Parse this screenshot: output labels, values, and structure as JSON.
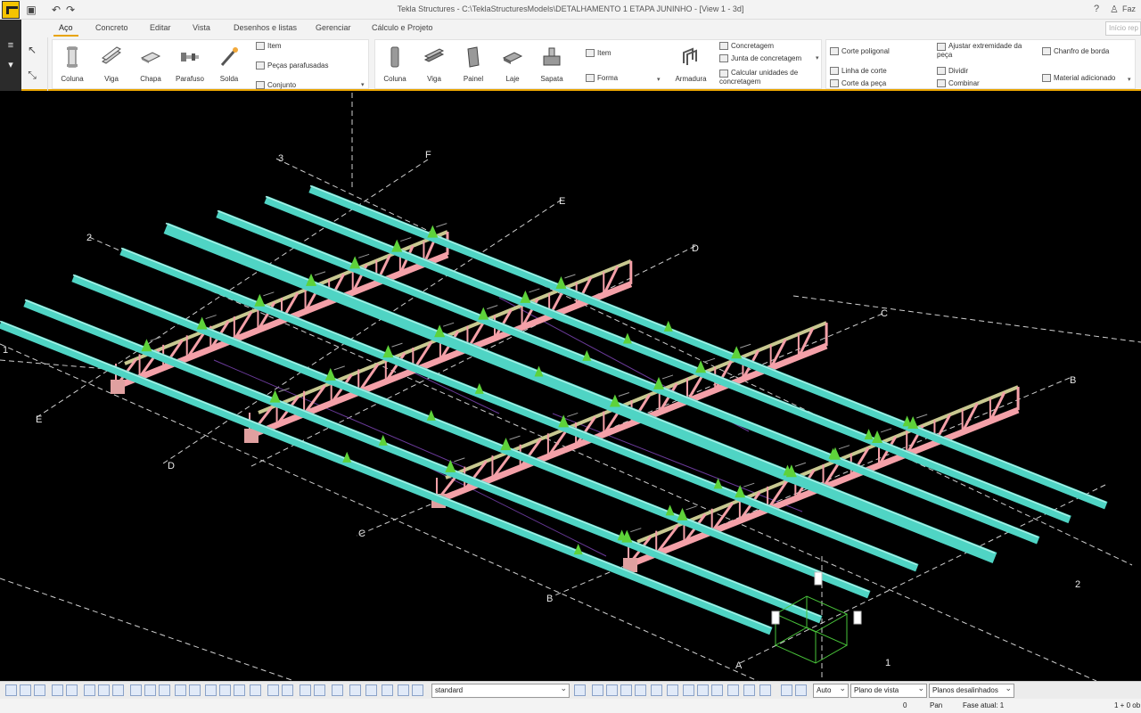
{
  "window": {
    "title": "Tekla Structures - C:\\TeklaStructuresModels\\DETALHAMENTO 1 ETAPA JUNINHO - [View 1 - 3d]",
    "help": "?",
    "user": "Faz"
  },
  "menu": {
    "tabs": [
      {
        "label": "Aço",
        "active": true
      },
      {
        "label": "Concreto"
      },
      {
        "label": "Editar"
      },
      {
        "label": "Vista"
      },
      {
        "label": "Desenhos e listas"
      },
      {
        "label": "Gerenciar"
      },
      {
        "label": "Cálculo e Projeto"
      }
    ],
    "search_placeholder": "Início rep"
  },
  "ribbon": {
    "steel": {
      "buttons": [
        {
          "label": "Coluna",
          "icon": "steel-column-icon"
        },
        {
          "label": "Viga",
          "icon": "steel-beam-icon"
        },
        {
          "label": "Chapa",
          "icon": "plate-icon"
        },
        {
          "label": "Parafuso",
          "icon": "bolt-icon"
        },
        {
          "label": "Solda",
          "icon": "weld-icon"
        }
      ],
      "small": [
        "Item",
        "Peças parafusadas",
        "Conjunto"
      ]
    },
    "concrete": {
      "buttons": [
        {
          "label": "Coluna",
          "icon": "concrete-column-icon"
        },
        {
          "label": "Viga",
          "icon": "concrete-beam-icon"
        },
        {
          "label": "Painel",
          "icon": "panel-icon"
        },
        {
          "label": "Laje",
          "icon": "slab-icon"
        },
        {
          "label": "Sapata",
          "icon": "footing-icon"
        }
      ],
      "small": [
        "Item",
        "Forma"
      ]
    },
    "rebar": {
      "label": "Armadura"
    },
    "pour": {
      "small": [
        "Concretagem",
        "Junta de concretagem",
        "Calcular unidades de concretagem"
      ]
    },
    "edit": {
      "small": [
        "Corte poligonal",
        "Linha de corte",
        "Corte da peça",
        "Ajustar extremidade da peça",
        "Dividir",
        "Combinar",
        "Chanfro de borda",
        "Material adicionado"
      ]
    }
  },
  "viewport": {
    "grid_labels": [
      "3",
      "F",
      "E",
      "D",
      "C",
      "B",
      "2",
      "1",
      "E",
      "D",
      "C",
      "B",
      "A",
      "1",
      "2"
    ],
    "colors": {
      "background": "#000000",
      "beam": "#4fd4c4",
      "truss": "#f4a0a8",
      "chord": "#c8c890",
      "grid": "#d0d0d0",
      "bracing": "#6a3a9a",
      "joint": "#5ed23a"
    }
  },
  "bottom_toolbar": {
    "filter": "standard",
    "snap": "Auto",
    "plane": "Plano de vista",
    "planes_option": "Planos desalinhados"
  },
  "status": {
    "left_value": "0",
    "mode": "Pan",
    "phase": "Fase atual: 1",
    "selection": "1 + 0 ob"
  }
}
